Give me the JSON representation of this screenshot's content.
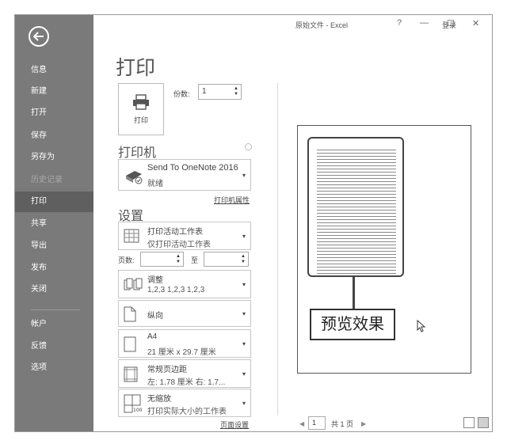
{
  "window": {
    "title": "原始文件 - Excel",
    "login": "登录",
    "help": "?",
    "minimize": "—",
    "maximize": "☐",
    "close": "✕"
  },
  "sidebar": {
    "back_icon": "back-arrow-icon",
    "items": [
      {
        "label": "信息"
      },
      {
        "label": "新建"
      },
      {
        "label": "打开"
      },
      {
        "label": "保存"
      },
      {
        "label": "另存为"
      },
      {
        "label": "历史记录"
      },
      {
        "label": "打印"
      },
      {
        "label": "共享"
      },
      {
        "label": "导出"
      },
      {
        "label": "发布"
      },
      {
        "label": "关闭"
      },
      {
        "label": "帐户"
      },
      {
        "label": "反馈"
      },
      {
        "label": "选项"
      }
    ]
  },
  "print": {
    "heading": "打印",
    "button_label": "打印",
    "copies_label": "份数:",
    "copies_value": "1"
  },
  "printer": {
    "heading": "打印机",
    "name": "Send To OneNote 2016",
    "status": "就绪",
    "properties_link": "打印机属性"
  },
  "settings": {
    "heading": "设置",
    "scope_title": "打印活动工作表",
    "scope_desc": "仅打印活动工作表",
    "pages_label": "页数:",
    "to_label": "至",
    "collate_title": "调整",
    "collate_desc": "1,2,3    1,2,3    1,2,3",
    "orientation": "纵向",
    "paper_title": "A4",
    "paper_desc": "21 厘米 x 29.7 厘米",
    "margins_title": "常规页边距",
    "margins_desc": "左: 1.78 厘米   右: 1.7...",
    "scaling_title": "无缩放",
    "scaling_desc": "打印实际大小的工作表",
    "page_setup_link": "页面设置"
  },
  "preview": {
    "callout": "预览效果",
    "page_number": "1",
    "page_total": "共 1 页"
  },
  "colors": {
    "sidebar_bg": "#7a7a7a",
    "sidebar_active": "#5f5f5f"
  }
}
